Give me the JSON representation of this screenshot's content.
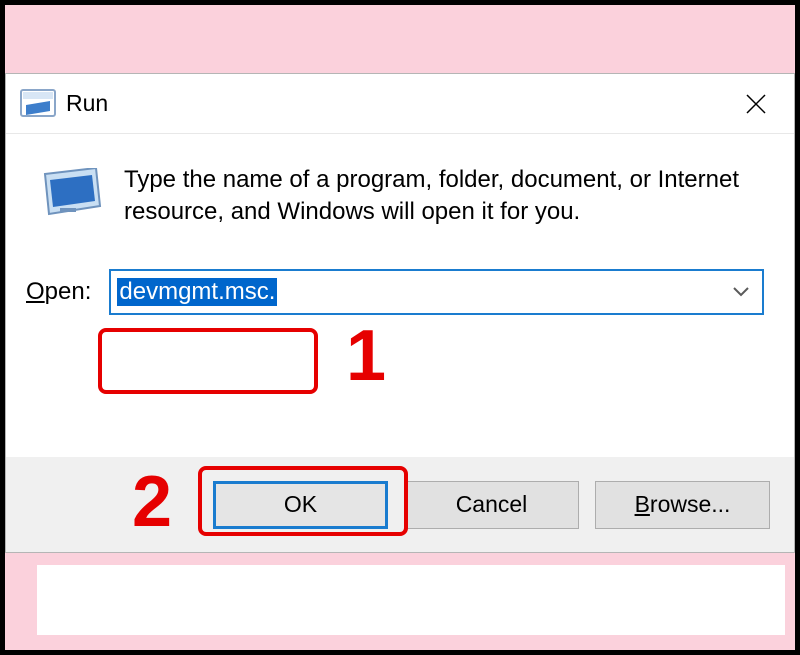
{
  "dialog": {
    "title": "Run",
    "description": "Type the name of a program, folder, document, or Internet resource, and Windows will open it for you.",
    "open_label_prefix": "O",
    "open_label_rest": "pen:",
    "input_value": "devmgmt.msc.",
    "buttons": {
      "ok": "OK",
      "cancel": "Cancel",
      "browse_prefix": "B",
      "browse_rest": "rowse..."
    }
  },
  "annotations": {
    "one": "1",
    "two": "2"
  }
}
